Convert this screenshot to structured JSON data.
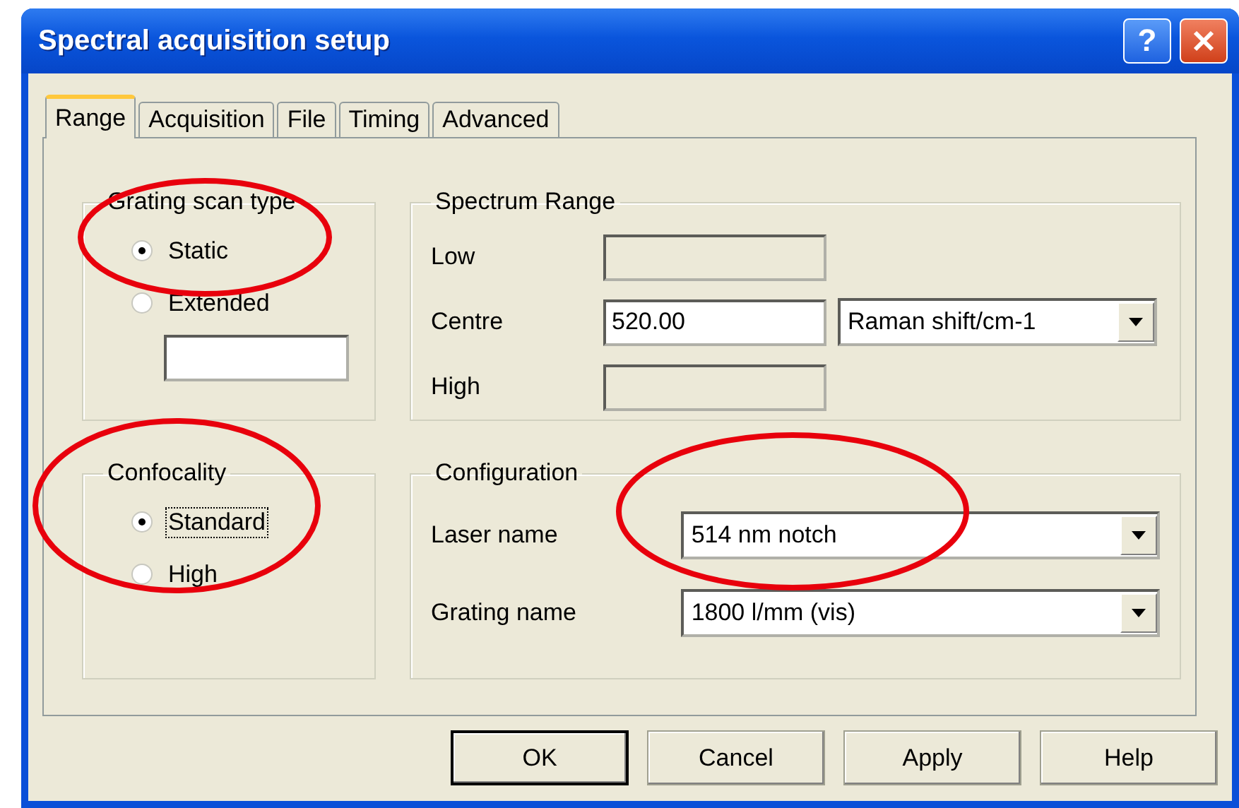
{
  "window": {
    "title": "Spectral acquisition setup",
    "help_button": "?"
  },
  "tabs": [
    {
      "label": "Range",
      "selected": true
    },
    {
      "label": "Acquisition",
      "selected": false
    },
    {
      "label": "File",
      "selected": false
    },
    {
      "label": "Timing",
      "selected": false
    },
    {
      "label": "Advanced",
      "selected": false
    }
  ],
  "grating_scan_type": {
    "title": "Grating scan type",
    "options": [
      {
        "label": "Static",
        "selected": true,
        "focused": false
      },
      {
        "label": "Extended",
        "selected": false,
        "focused": false
      }
    ]
  },
  "confocality": {
    "title": "Confocality",
    "options": [
      {
        "label": "Standard",
        "selected": true,
        "focused": true
      },
      {
        "label": "High",
        "selected": false,
        "focused": false
      }
    ]
  },
  "spectrum_range": {
    "title": "Spectrum Range",
    "fields": [
      {
        "label": "Low",
        "disabled": true
      },
      {
        "label": "Centre",
        "value": "520.00",
        "disabled": false,
        "units": "Raman shift/cm-1"
      },
      {
        "label": "High",
        "disabled": true
      }
    ]
  },
  "configuration": {
    "title": "Configuration",
    "fields": [
      {
        "label": "Laser name",
        "value": "514 nm notch"
      },
      {
        "label": "Grating name",
        "value": "1800 l/mm (vis)"
      }
    ]
  },
  "buttons": [
    {
      "label": "OK",
      "default": true
    },
    {
      "label": "Cancel",
      "default": false
    },
    {
      "label": "Apply",
      "default": false
    },
    {
      "label": "Help",
      "default": false
    }
  ]
}
